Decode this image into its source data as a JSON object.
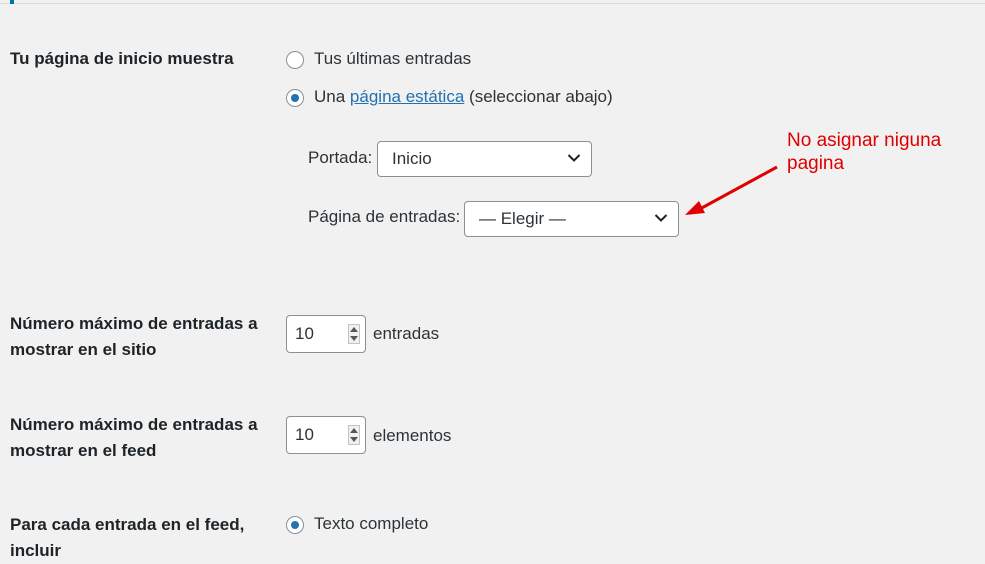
{
  "homepage": {
    "label": "Tu página de inicio muestra",
    "option_latest": "Tus últimas entradas",
    "option_static_prefix": "Una",
    "option_static_link": "página estática",
    "option_static_suffix": "(seleccionar abajo)",
    "selected": "static",
    "front_label": "Portada:",
    "front_value": "Inicio",
    "posts_label": "Página de entradas:",
    "posts_value": "— Elegir —"
  },
  "annotation": {
    "text": "No asignar niguna pagina",
    "color": "#e00000"
  },
  "posts_per_page": {
    "label": "Número máximo de entradas a mostrar en el sitio",
    "value": "10",
    "unit": "entradas"
  },
  "posts_per_rss": {
    "label": "Número máximo de entradas a mostrar en el feed",
    "value": "10",
    "unit": "elementos"
  },
  "rss_use_excerpt": {
    "label": "Para cada entrada en el feed, incluir",
    "option_full": "Texto completo",
    "selected": "full"
  },
  "colors": {
    "accent": "#2271b1",
    "background": "#f1f1f1"
  }
}
